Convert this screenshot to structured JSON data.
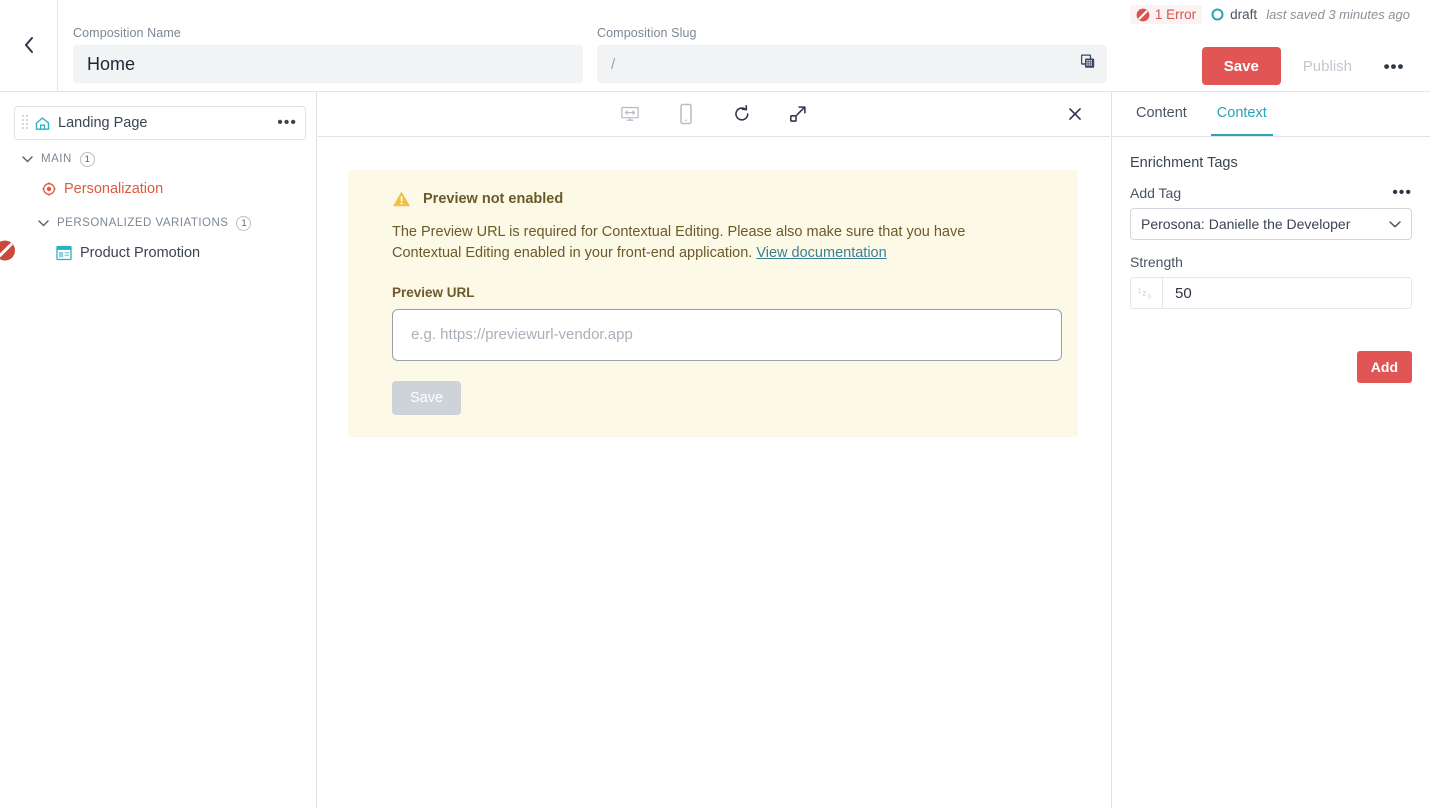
{
  "topbar": {
    "back_icon": "chevron-left-icon",
    "composition_name": {
      "label": "Composition Name",
      "value": "Home"
    },
    "composition_slug": {
      "label": "Composition Slug",
      "value": "/",
      "copy_icon": "copy-icon"
    },
    "status": {
      "error_icon": "error-slash-icon",
      "error_text": "1 Error",
      "draft_icon": "circle-outline-icon",
      "draft_text": "draft",
      "last_saved": "last saved 3 minutes ago"
    },
    "actions": {
      "save_label": "Save",
      "publish_label": "Publish",
      "more_icon": "more-horizontal-icon"
    },
    "colors": {
      "accent_red": "#e15554",
      "teal": "#29a3b8",
      "error_red": "#d9534f"
    }
  },
  "sidebar": {
    "root": {
      "label": "Landing Page",
      "icon": "home-icon",
      "drag_icon": "drag-handle-icon",
      "menu_icon": "more-horizontal-icon"
    },
    "sections": [
      {
        "label": "MAIN",
        "count": "1",
        "chevron_icon": "chevron-down-icon",
        "items": [
          {
            "label": "Personalization",
            "icon": "target-icon",
            "kind": "personalization"
          }
        ]
      },
      {
        "label": "PERSONALIZED VARIATIONS",
        "count": "1",
        "chevron_icon": "chevron-down-icon",
        "items": [
          {
            "label": "Product Promotion",
            "icon": "layout-template-icon",
            "kind": "variation",
            "error_icon": "error-slash-icon"
          }
        ]
      }
    ]
  },
  "center": {
    "toolbar": {
      "desktop_icon": "desktop-resize-icon",
      "mobile_icon": "mobile-device-icon",
      "refresh_icon": "refresh-icon",
      "expand_icon": "expand-arrow-icon",
      "close_icon": "close-icon"
    },
    "warning": {
      "icon": "warning-triangle-icon",
      "title": "Preview not enabled",
      "body": "The Preview URL is required for Contextual Editing. Please also make sure that you have Contextual Editing enabled in your front-end application.",
      "link_text": "View documentation",
      "field_label": "Preview URL",
      "input_placeholder": "e.g. https://previewurl-vendor.app",
      "input_value": "",
      "save_label": "Save",
      "background_color": "#fdf9e7",
      "text_color": "#6b5a2a"
    }
  },
  "right_panel": {
    "tabs": [
      {
        "label": "Content",
        "active": false
      },
      {
        "label": "Context",
        "active": true
      }
    ],
    "section_title": "Enrichment Tags",
    "add_tag": {
      "label": "Add Tag",
      "menu_icon": "more-horizontal-icon",
      "selected_option": "Perosona: Danielle the Developer",
      "chevron_icon": "chevron-down-icon"
    },
    "strength": {
      "label": "Strength",
      "type_icon": "number-123-icon",
      "value": "50"
    },
    "add_button_label": "Add"
  }
}
